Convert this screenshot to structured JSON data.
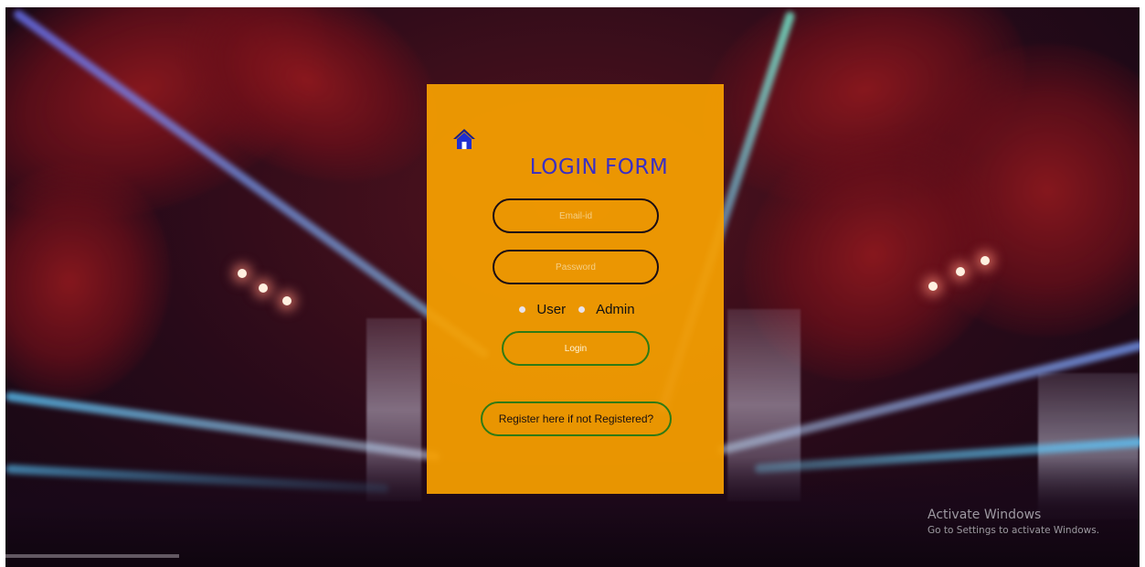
{
  "login_form": {
    "home_icon": "home-icon",
    "title": "LOGIN FORM",
    "email_placeholder": "Email-id",
    "password_placeholder": "Password",
    "roles": [
      {
        "label": "User"
      },
      {
        "label": "Admin"
      }
    ],
    "login_label": "Login",
    "register_label": "Register here if not Registered?"
  },
  "colors": {
    "card_background": "#f8a000",
    "title": "#3a2fc4",
    "input_border": "#1a0d14",
    "button_border": "#2f7a14"
  },
  "watermark": {
    "title": "Activate Windows",
    "subtitle": "Go to Settings to activate Windows."
  }
}
